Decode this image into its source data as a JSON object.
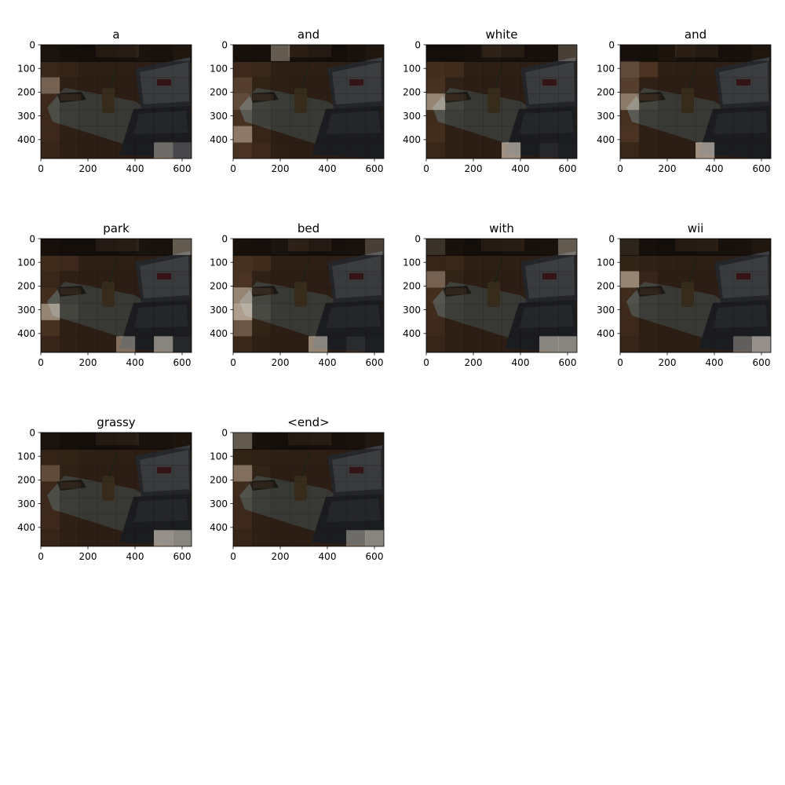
{
  "figure": {
    "background": "#ffffff",
    "panel_titles": [
      "a",
      "and",
      "white",
      "and",
      "park",
      "bed",
      "with",
      "wii",
      "grassy",
      "<end>"
    ]
  },
  "chart_data": {
    "type": "heatmap",
    "description_of_panels": "attention overlays per decoded word",
    "image_extent": {
      "x": [
        0,
        640
      ],
      "y": [
        0,
        480
      ]
    },
    "x_ticks": [
      "0",
      "200",
      "400",
      "600"
    ],
    "y_ticks": [
      "0",
      "100",
      "200",
      "300",
      "400"
    ],
    "grid": false,
    "grid_shape": [
      7,
      8
    ],
    "colormap": "Greys_r",
    "panels": [
      {
        "word": "a",
        "weights": [
          [
            0.35,
            0.12,
            0.1,
            0.08,
            0.15,
            0.3,
            0.25,
            0.45
          ],
          [
            0.25,
            0.18,
            0.1,
            0.08,
            0.08,
            0.06,
            0.08,
            0.08
          ],
          [
            0.7,
            0.1,
            0.05,
            0.05,
            0.05,
            0.05,
            0.05,
            0.05
          ],
          [
            0.3,
            0.1,
            0.05,
            0.05,
            0.05,
            0.05,
            0.05,
            0.05
          ],
          [
            0.3,
            0.1,
            0.05,
            0.05,
            0.05,
            0.05,
            0.05,
            0.05
          ],
          [
            0.3,
            0.1,
            0.05,
            0.05,
            0.05,
            0.05,
            0.05,
            0.05
          ],
          [
            0.2,
            0.1,
            0.05,
            0.05,
            0.05,
            0.05,
            0.75,
            0.6
          ]
        ]
      },
      {
        "word": "and",
        "weights": [
          [
            0.2,
            0.15,
            0.75,
            0.2,
            0.1,
            0.1,
            0.25,
            0.45
          ],
          [
            0.3,
            0.25,
            0.1,
            0.08,
            0.08,
            0.06,
            0.08,
            0.08
          ],
          [
            0.55,
            0.15,
            0.08,
            0.05,
            0.05,
            0.05,
            0.05,
            0.05
          ],
          [
            0.6,
            0.15,
            0.08,
            0.05,
            0.05,
            0.05,
            0.05,
            0.05
          ],
          [
            0.45,
            0.12,
            0.06,
            0.05,
            0.05,
            0.05,
            0.05,
            0.05
          ],
          [
            0.8,
            0.2,
            0.05,
            0.05,
            0.05,
            0.05,
            0.05,
            0.05
          ],
          [
            0.5,
            0.3,
            0.1,
            0.05,
            0.05,
            0.05,
            0.05,
            0.05
          ]
        ]
      },
      {
        "word": "white",
        "weights": [
          [
            0.1,
            0.1,
            0.15,
            0.3,
            0.15,
            0.15,
            0.2,
            0.65
          ],
          [
            0.4,
            0.35,
            0.1,
            0.08,
            0.08,
            0.06,
            0.08,
            0.08
          ],
          [
            0.45,
            0.12,
            0.06,
            0.05,
            0.05,
            0.05,
            0.05,
            0.05
          ],
          [
            0.85,
            0.2,
            0.05,
            0.05,
            0.05,
            0.05,
            0.05,
            0.05
          ],
          [
            0.35,
            0.1,
            0.05,
            0.05,
            0.05,
            0.05,
            0.05,
            0.05
          ],
          [
            0.4,
            0.1,
            0.05,
            0.05,
            0.05,
            0.05,
            0.05,
            0.05
          ],
          [
            0.25,
            0.1,
            0.05,
            0.05,
            0.9,
            0.05,
            0.3,
            0.1
          ]
        ]
      },
      {
        "word": "and",
        "weights": [
          [
            0.15,
            0.12,
            0.4,
            0.2,
            0.1,
            0.15,
            0.2,
            0.45
          ],
          [
            0.6,
            0.5,
            0.1,
            0.08,
            0.08,
            0.06,
            0.08,
            0.08
          ],
          [
            0.55,
            0.12,
            0.06,
            0.05,
            0.05,
            0.05,
            0.05,
            0.05
          ],
          [
            0.8,
            0.2,
            0.05,
            0.05,
            0.05,
            0.05,
            0.05,
            0.05
          ],
          [
            0.45,
            0.1,
            0.05,
            0.05,
            0.05,
            0.05,
            0.05,
            0.05
          ],
          [
            0.5,
            0.1,
            0.05,
            0.05,
            0.05,
            0.05,
            0.05,
            0.05
          ],
          [
            0.25,
            0.1,
            0.05,
            0.05,
            0.9,
            0.05,
            0.05,
            0.05
          ]
        ]
      },
      {
        "word": "park",
        "weights": [
          [
            0.15,
            0.1,
            0.08,
            0.1,
            0.15,
            0.3,
            0.25,
            0.75
          ],
          [
            0.35,
            0.3,
            0.1,
            0.08,
            0.08,
            0.06,
            0.08,
            0.08
          ],
          [
            0.25,
            0.1,
            0.05,
            0.05,
            0.05,
            0.05,
            0.05,
            0.05
          ],
          [
            0.4,
            0.12,
            0.05,
            0.05,
            0.05,
            0.05,
            0.05,
            0.05
          ],
          [
            0.85,
            0.2,
            0.06,
            0.05,
            0.05,
            0.05,
            0.05,
            0.05
          ],
          [
            0.45,
            0.1,
            0.05,
            0.05,
            0.05,
            0.05,
            0.05,
            0.05
          ],
          [
            0.2,
            0.1,
            0.05,
            0.05,
            0.75,
            0.05,
            0.85,
            0.3
          ]
        ]
      },
      {
        "word": "bed",
        "weights": [
          [
            0.2,
            0.15,
            0.35,
            0.25,
            0.1,
            0.15,
            0.25,
            0.65
          ],
          [
            0.45,
            0.35,
            0.1,
            0.08,
            0.08,
            0.06,
            0.08,
            0.08
          ],
          [
            0.5,
            0.12,
            0.06,
            0.05,
            0.05,
            0.05,
            0.05,
            0.05
          ],
          [
            0.85,
            0.2,
            0.05,
            0.05,
            0.05,
            0.05,
            0.05,
            0.05
          ],
          [
            0.95,
            0.25,
            0.06,
            0.05,
            0.05,
            0.05,
            0.05,
            0.05
          ],
          [
            0.65,
            0.15,
            0.05,
            0.05,
            0.05,
            0.05,
            0.05,
            0.05
          ],
          [
            0.25,
            0.1,
            0.05,
            0.05,
            0.85,
            0.05,
            0.4,
            0.1
          ]
        ]
      },
      {
        "word": "with",
        "weights": [
          [
            0.6,
            0.2,
            0.1,
            0.08,
            0.15,
            0.2,
            0.25,
            0.75
          ],
          [
            0.2,
            0.25,
            0.1,
            0.08,
            0.08,
            0.06,
            0.08,
            0.08
          ],
          [
            0.7,
            0.15,
            0.06,
            0.05,
            0.05,
            0.05,
            0.05,
            0.05
          ],
          [
            0.4,
            0.12,
            0.05,
            0.05,
            0.05,
            0.05,
            0.05,
            0.05
          ],
          [
            0.35,
            0.1,
            0.05,
            0.05,
            0.05,
            0.05,
            0.05,
            0.05
          ],
          [
            0.3,
            0.1,
            0.05,
            0.05,
            0.05,
            0.05,
            0.05,
            0.05
          ],
          [
            0.2,
            0.1,
            0.05,
            0.05,
            0.05,
            0.05,
            0.85,
            0.85
          ]
        ]
      },
      {
        "word": "wii",
        "weights": [
          [
            0.55,
            0.15,
            0.1,
            0.08,
            0.15,
            0.2,
            0.25,
            0.5
          ],
          [
            0.15,
            0.12,
            0.1,
            0.08,
            0.08,
            0.06,
            0.08,
            0.08
          ],
          [
            0.85,
            0.2,
            0.06,
            0.05,
            0.05,
            0.05,
            0.05,
            0.05
          ],
          [
            0.35,
            0.1,
            0.05,
            0.05,
            0.05,
            0.05,
            0.05,
            0.05
          ],
          [
            0.3,
            0.1,
            0.05,
            0.05,
            0.05,
            0.05,
            0.05,
            0.05
          ],
          [
            0.3,
            0.1,
            0.05,
            0.05,
            0.05,
            0.05,
            0.05,
            0.05
          ],
          [
            0.2,
            0.1,
            0.05,
            0.05,
            0.05,
            0.05,
            0.7,
            0.9
          ]
        ]
      },
      {
        "word": "grassy",
        "weights": [
          [
            0.35,
            0.12,
            0.1,
            0.08,
            0.15,
            0.25,
            0.25,
            0.4
          ],
          [
            0.18,
            0.15,
            0.1,
            0.08,
            0.08,
            0.06,
            0.08,
            0.08
          ],
          [
            0.6,
            0.12,
            0.06,
            0.05,
            0.05,
            0.05,
            0.05,
            0.05
          ],
          [
            0.3,
            0.1,
            0.05,
            0.05,
            0.05,
            0.05,
            0.05,
            0.05
          ],
          [
            0.3,
            0.1,
            0.05,
            0.05,
            0.05,
            0.05,
            0.05,
            0.05
          ],
          [
            0.3,
            0.1,
            0.05,
            0.05,
            0.05,
            0.05,
            0.05,
            0.05
          ],
          [
            0.2,
            0.1,
            0.05,
            0.05,
            0.05,
            0.05,
            0.9,
            0.85
          ]
        ]
      },
      {
        "word": "<end>",
        "weights": [
          [
            0.75,
            0.2,
            0.1,
            0.08,
            0.15,
            0.2,
            0.25,
            0.5
          ],
          [
            0.15,
            0.12,
            0.1,
            0.08,
            0.08,
            0.06,
            0.08,
            0.08
          ],
          [
            0.75,
            0.15,
            0.06,
            0.05,
            0.05,
            0.05,
            0.05,
            0.05
          ],
          [
            0.35,
            0.1,
            0.05,
            0.05,
            0.05,
            0.05,
            0.05,
            0.05
          ],
          [
            0.3,
            0.1,
            0.05,
            0.05,
            0.05,
            0.05,
            0.05,
            0.05
          ],
          [
            0.3,
            0.1,
            0.05,
            0.05,
            0.05,
            0.05,
            0.05,
            0.05
          ],
          [
            0.2,
            0.1,
            0.05,
            0.05,
            0.05,
            0.05,
            0.75,
            0.85
          ]
        ]
      }
    ]
  }
}
